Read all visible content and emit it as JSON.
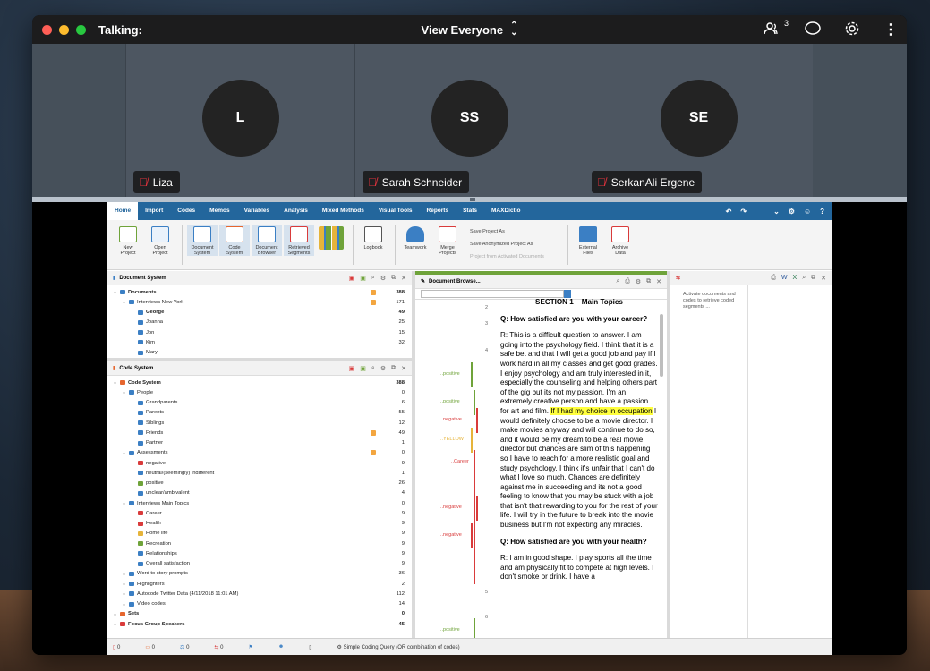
{
  "topbar": {
    "title": "Talking:",
    "view_label": "View Everyone",
    "participant_count": "3"
  },
  "participants": [
    {
      "initials": "L",
      "name": "Liza"
    },
    {
      "initials": "SS",
      "name": "Sarah Schneider"
    },
    {
      "initials": "SE",
      "name": "SerkanAli Ergene"
    }
  ],
  "maxqda": {
    "menu": [
      "Home",
      "Import",
      "Codes",
      "Memos",
      "Variables",
      "Analysis",
      "Mixed Methods",
      "Visual Tools",
      "Reports",
      "Stats",
      "MAXDictio"
    ],
    "ribbon": [
      {
        "label": "New\nProject"
      },
      {
        "label": "Open\nProject"
      },
      {
        "label": "Document\nSystem"
      },
      {
        "label": "Code\nSystem"
      },
      {
        "label": "Document\nBrowser"
      },
      {
        "label": "Retrieved\nSegments"
      },
      {
        "label": "Logbook"
      },
      {
        "label": "Teamwork"
      },
      {
        "label": "Merge\nProjects"
      },
      {
        "label": "External\nFiles"
      },
      {
        "label": "Archive\nData"
      }
    ],
    "save_project_as": "Save Project As",
    "save_anon": "Save Anonymized Project As",
    "project_from_activated": "Project from Activated Documents",
    "doc_system_title": "Document System",
    "doc_tree": [
      {
        "label": "Documents",
        "count": "388",
        "bold": true,
        "level": 0
      },
      {
        "label": "Interviews New York",
        "count": "171",
        "level": 1
      },
      {
        "label": "George",
        "count": "49",
        "bold": true,
        "level": 2
      },
      {
        "label": "Joanna",
        "count": "25",
        "level": 2
      },
      {
        "label": "Jon",
        "count": "15",
        "level": 2
      },
      {
        "label": "Kim",
        "count": "32",
        "level": 2
      },
      {
        "label": "Mary",
        "count": "",
        "level": 2
      }
    ],
    "code_system_title": "Code System",
    "code_tree": [
      {
        "label": "Code System",
        "count": "388",
        "bold": true,
        "level": 0,
        "color": "#e6662e"
      },
      {
        "label": "People",
        "count": "0",
        "level": 1,
        "color": "#3b7fc4"
      },
      {
        "label": "Grandparents",
        "count": "6",
        "level": 2,
        "color": "#3b7fc4"
      },
      {
        "label": "Parents",
        "count": "55",
        "level": 2,
        "color": "#3b7fc4"
      },
      {
        "label": "Siblings",
        "count": "12",
        "level": 2,
        "color": "#3b7fc4"
      },
      {
        "label": "Friends",
        "count": "49",
        "level": 2,
        "color": "#3b7fc4"
      },
      {
        "label": "Partner",
        "count": "1",
        "level": 2,
        "color": "#3b7fc4"
      },
      {
        "label": "Assessments",
        "count": "0",
        "level": 1,
        "color": "#3b7fc4"
      },
      {
        "label": "negative",
        "count": "9",
        "level": 2,
        "color": "#d93b3b"
      },
      {
        "label": "neutral/(seemingly) indifferent",
        "count": "1",
        "level": 2,
        "color": "#3b7fc4"
      },
      {
        "label": "positive",
        "count": "26",
        "level": 2,
        "color": "#6fa33a"
      },
      {
        "label": "unclear/ambivalent",
        "count": "4",
        "level": 2,
        "color": "#3b7fc4"
      },
      {
        "label": "Interviews Main Topics",
        "count": "0",
        "level": 1,
        "color": "#3b7fc4"
      },
      {
        "label": "Career",
        "count": "9",
        "level": 2,
        "color": "#d93b3b"
      },
      {
        "label": "Health",
        "count": "9",
        "level": 2,
        "color": "#d93b3b"
      },
      {
        "label": "Home life",
        "count": "9",
        "level": 2,
        "color": "#e6b43a"
      },
      {
        "label": "Recreation",
        "count": "9",
        "level": 2,
        "color": "#6fa33a"
      },
      {
        "label": "Relationships",
        "count": "9",
        "level": 2,
        "color": "#3b7fc4"
      },
      {
        "label": "Overall satisfaction",
        "count": "9",
        "level": 2,
        "color": "#3b7fc4"
      },
      {
        "label": "Word to story prompts",
        "count": "36",
        "level": 1,
        "color": "#3b7fc4"
      },
      {
        "label": "Highlighters",
        "count": "2",
        "level": 1,
        "color": "#3b7fc4"
      },
      {
        "label": "Autocode Twitter Data (4/11/2018 11:01 AM)",
        "count": "112",
        "level": 1,
        "color": "#3b7fc4"
      },
      {
        "label": "Video codes",
        "count": "14",
        "level": 1,
        "color": "#3b7fc4"
      },
      {
        "label": "Sets",
        "count": "0",
        "bold": true,
        "level": 0,
        "color": "#e6662e"
      },
      {
        "label": "Focus Group Speakers",
        "count": "45",
        "bold": true,
        "level": 0,
        "color": "#d93b3b"
      }
    ],
    "doc_browser_title": "Document Browse...",
    "doc": {
      "p2": "SECTION 1 – Main Topics",
      "p3": "Q: How satisfied are you with your career?",
      "p4_before": "R: This is a difficult question to answer. I am going into the psychology field. I think that it is a safe bet and that I will get a good job and pay if I work hard in all my classes and get good grades. I enjoy psychology and am truly interested in it, especially the counseling and helping others part of the gig but its not my passion. I'm an extremely creative person and have a passion for art and film. ",
      "p4_highlight": "If I had my choice in occupation",
      "p4_after": " I would definitely choose to be a movie director. I make movies anyway and will continue to do so, and it would be my dream to be a real movie director but chances are slim of this happening so I have to reach for a more realistic goal and study psychology. I think it's unfair that I can't do what I love so much. Chances are definitely against me in succeeding and its not a good feeling to know that you may be stuck with a job that isn't that rewarding to you for the rest of your life. I will try in the future to break into the movie business but I'm not expecting any miracles.",
      "p5": "Q: How satisfied are you with your health?",
      "p6": "R: I am in good shape. I play sports all the time and am physically fit to compete at high levels. I don't smoke or drink. I have a"
    },
    "para_numbers": [
      "2",
      "3",
      "4",
      "5",
      "6"
    ],
    "code_stripes": [
      "..positive",
      "..positive",
      "..negative",
      "..YELLOW",
      "..Career",
      "..negative",
      "..negative",
      "..positive"
    ],
    "retrieved_info": "Activate documents and codes to retrieve coded segments ...",
    "status": {
      "s1": "0",
      "s2": "0",
      "s3": "0",
      "s4": "0",
      "query": "Simple Coding Query (OR combination of codes)"
    }
  }
}
